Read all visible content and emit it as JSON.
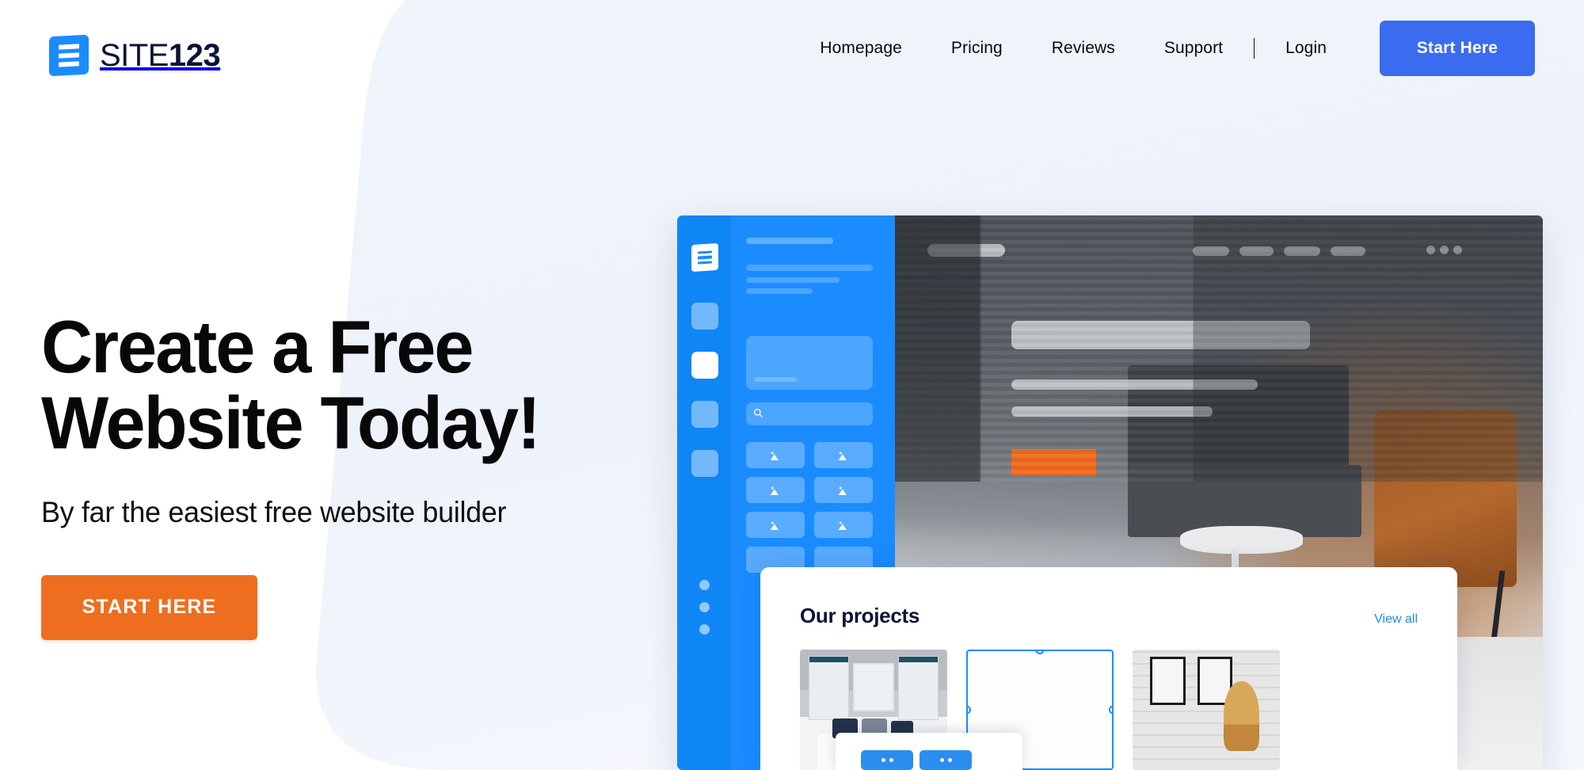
{
  "brand": {
    "name_light": "SITE",
    "name_bold": "123",
    "logo_icon": "site123-logo-icon",
    "primary_blue": "#1A8CFF",
    "nav_button_blue": "#3B6BEF",
    "cta_orange": "#ED6E1F",
    "navy": "#0B1437",
    "page_bg": "#FFFFFF",
    "panel_bg": "#EFF3FA"
  },
  "header": {
    "nav_links": [
      {
        "label": "Homepage",
        "name": "nav-link-homepage"
      },
      {
        "label": "Pricing",
        "name": "nav-link-pricing"
      },
      {
        "label": "Reviews",
        "name": "nav-link-reviews"
      },
      {
        "label": "Support",
        "name": "nav-link-support"
      }
    ],
    "separator": "|",
    "login_label": "Login",
    "start_here_label": "Start Here"
  },
  "hero": {
    "headline": "Create a Free\nWebsite Today!",
    "subheadline": "By far the easiest free website builder",
    "cta_label": "START HERE"
  },
  "mockup": {
    "rail": {
      "logo_icon": "site123-mark-icon",
      "nav_squares": [
        {
          "name": "rail-item-1",
          "active": false
        },
        {
          "name": "rail-item-2",
          "active": true
        },
        {
          "name": "rail-item-3",
          "active": false
        },
        {
          "name": "rail-item-4",
          "active": false
        }
      ],
      "bottom_dots": 3
    },
    "panel": {
      "search_icon": "search-icon",
      "search_placeholder": "",
      "media_tiles": 8,
      "tile_icon": "image-placeholder-icon"
    },
    "site_preview": {
      "topbar_nav_pills": 4,
      "topbar_menu_dots": 3,
      "hero_cta_color": "#F26B1E"
    },
    "projects": {
      "title": "Our projects",
      "view_all_label": "View all",
      "thumbnails": [
        {
          "name": "project-thumb-bedroom",
          "selected": false
        },
        {
          "name": "project-thumb-empty",
          "selected": true
        },
        {
          "name": "project-thumb-brick-wall",
          "selected": false
        },
        {
          "name": "project-thumb-fireplace",
          "selected": false
        }
      ],
      "popover_buttons": [
        {
          "name": "popover-action-1"
        },
        {
          "name": "popover-action-2"
        }
      ]
    }
  }
}
